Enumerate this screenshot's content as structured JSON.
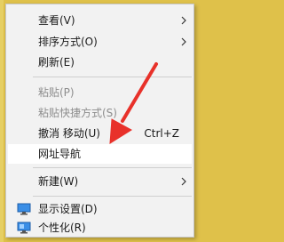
{
  "context_menu": {
    "items": [
      {
        "label": "查看(V)"
      },
      {
        "label": "排序方式(O)"
      },
      {
        "label": "刷新(E)"
      },
      {
        "label": "粘贴(P)"
      },
      {
        "label": "粘贴快捷方式(S)"
      },
      {
        "label": "撤消 移动(U)",
        "shortcut": "Ctrl+Z"
      },
      {
        "label": "网址导航"
      },
      {
        "label": "新建(W)"
      },
      {
        "label": "显示设置(D)",
        "icon": "display-icon"
      },
      {
        "label": "个性化(R)",
        "icon": "personalize-icon"
      }
    ]
  },
  "annotation": {
    "color": "#e8312a"
  },
  "colors": {
    "background": "#dfc14a",
    "menu": "#f2f2f2",
    "highlight": "#ffffff",
    "disabled": "#8d8d8d"
  }
}
